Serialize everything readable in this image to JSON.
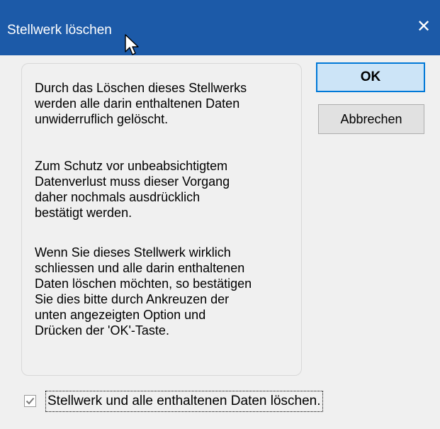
{
  "window": {
    "title": "Stellwerk löschen",
    "close_glyph": "✕"
  },
  "message": {
    "paragraphs": [
      "Durch das Löschen dieses Stellwerks\nwerden alle darin enthaltenen Daten\nunwiderruflich gelöscht.",
      "Zum Schutz vor unbeabsichtigtem\nDatenverlust muss dieser Vorgang\ndaher nochmals ausdrücklich\nbestätigt werden.",
      "Wenn Sie dieses Stellwerk wirklich\nschliessen und alle darin enthaltenen\nDaten löschen möchten, so bestätigen\nSie dies bitte durch Ankreuzen der\nunten angezeigten Option und\nDrücken der 'OK'-Taste."
    ]
  },
  "buttons": {
    "ok_label": "OK",
    "cancel_label": "Abbrechen"
  },
  "confirm_checkbox": {
    "label": "Stellwerk und alle enthaltenen Daten löschen.",
    "checked": true
  },
  "colors": {
    "titlebar": "#1c5aa8",
    "dialog_bg": "#f0f0f0",
    "ok_bg": "#cce4f7",
    "ok_border": "#0078d7"
  }
}
